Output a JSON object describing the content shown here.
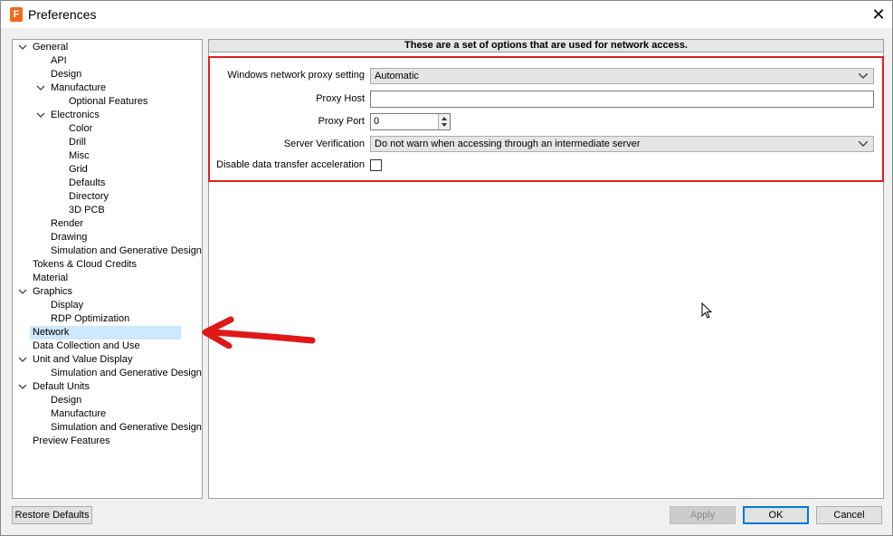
{
  "window": {
    "title": "Preferences",
    "app_icon_letter": "F"
  },
  "tree": [
    {
      "label": "General",
      "level": 0,
      "expanded": true
    },
    {
      "label": "API",
      "level": 1
    },
    {
      "label": "Design",
      "level": 1
    },
    {
      "label": "Manufacture",
      "level": 1,
      "expanded": true
    },
    {
      "label": "Optional Features",
      "level": 2
    },
    {
      "label": "Electronics",
      "level": 1,
      "expanded": true
    },
    {
      "label": "Color",
      "level": 2
    },
    {
      "label": "Drill",
      "level": 2
    },
    {
      "label": "Misc",
      "level": 2
    },
    {
      "label": "Grid",
      "level": 2
    },
    {
      "label": "Defaults",
      "level": 2
    },
    {
      "label": "Directory",
      "level": 2
    },
    {
      "label": "3D PCB",
      "level": 2
    },
    {
      "label": "Render",
      "level": 1
    },
    {
      "label": "Drawing",
      "level": 1
    },
    {
      "label": "Simulation and Generative Design",
      "level": 1
    },
    {
      "label": "Tokens & Cloud Credits",
      "level": 0
    },
    {
      "label": "Material",
      "level": 0
    },
    {
      "label": "Graphics",
      "level": 0,
      "expanded": true
    },
    {
      "label": "Display",
      "level": 1
    },
    {
      "label": "RDP Optimization",
      "level": 1
    },
    {
      "label": "Network",
      "level": 0,
      "selected": true
    },
    {
      "label": "Data Collection and Use",
      "level": 0
    },
    {
      "label": "Unit and Value Display",
      "level": 0,
      "expanded": true
    },
    {
      "label": "Simulation and Generative Design",
      "level": 1
    },
    {
      "label": "Default Units",
      "level": 0,
      "expanded": true
    },
    {
      "label": "Design",
      "level": 1
    },
    {
      "label": "Manufacture",
      "level": 1
    },
    {
      "label": "Simulation and Generative Design",
      "level": 1
    },
    {
      "label": "Preview Features",
      "level": 0
    }
  ],
  "panel": {
    "header": "These are a set of options that are used for network access.",
    "proxy_setting": {
      "label": "Windows network proxy setting",
      "value": "Automatic"
    },
    "proxy_host": {
      "label": "Proxy Host",
      "value": ""
    },
    "proxy_port": {
      "label": "Proxy Port",
      "value": "0"
    },
    "server_verification": {
      "label": "Server Verification",
      "value": "Do not warn when accessing through an intermediate server"
    },
    "disable_accel": {
      "label": "Disable data transfer acceleration",
      "checked": false
    }
  },
  "buttons": {
    "restore_defaults": "Restore Defaults",
    "apply": "Apply",
    "ok": "OK",
    "cancel": "Cancel"
  },
  "colors": {
    "highlight_border": "#e02020",
    "annotation_arrow": "#e01818",
    "selection": "#cde8ff",
    "app_icon": "#f26b1d"
  }
}
